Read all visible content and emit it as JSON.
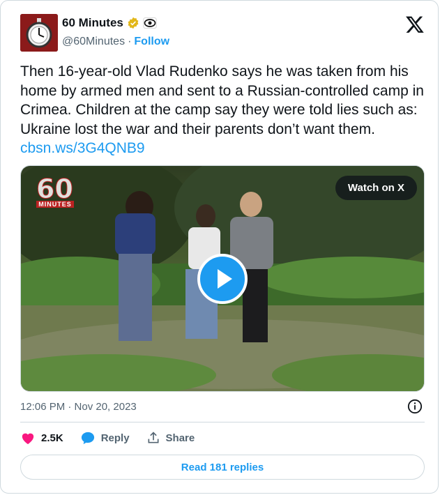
{
  "author": {
    "name": "60 Minutes",
    "handle": "@60Minutes",
    "separator": "·",
    "follow_label": "Follow"
  },
  "tweet": {
    "text": "Then 16-year-old Vlad Rudenko says he was taken from his home by armed men and sent to a Russian-controlled camp in Crimea. Children at the camp say they were told lies such as: Ukraine lost the war and their parents don’t want them. ",
    "link": "cbsn.ws/3G4QNB9"
  },
  "media": {
    "watch_label": "Watch on X",
    "logo_number": "60",
    "logo_word": "MINUTES"
  },
  "timestamp": "12:06 PM · Nov 20, 2023",
  "actions": {
    "likes": "2.5K",
    "reply_label": "Reply",
    "share_label": "Share"
  },
  "replies_button": "Read 181 replies",
  "colors": {
    "accent": "#1d9bf0",
    "like": "#f91880",
    "verified_gold": "#e2b719"
  }
}
